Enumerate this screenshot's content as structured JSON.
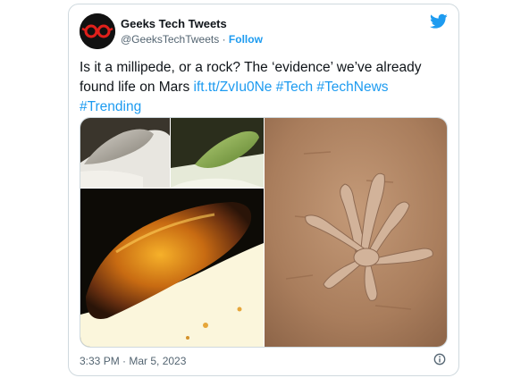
{
  "tweet": {
    "author_name": "Geeks Tech Tweets",
    "handle": "@GeeksTechTweets",
    "separator": "·",
    "follow_label": "Follow",
    "text_part1": "Is it a millipede, or a rock? The ‘evidence’ we’ve already found life on Mars ",
    "link": "ift.tt/ZvIu0Ne",
    "hashtags": [
      "#Tech",
      "#TechNews",
      "#Trending"
    ],
    "timestamp": "3:33 PM · Mar 5, 2023"
  },
  "icons": {
    "avatar": "glasses-logo-icon",
    "brand": "twitter-bird-icon",
    "info": "info-icon"
  },
  "colors": {
    "accent": "#1d9bf0",
    "text": "#0f1419",
    "muted": "#536471",
    "border": "#cfd9de"
  }
}
